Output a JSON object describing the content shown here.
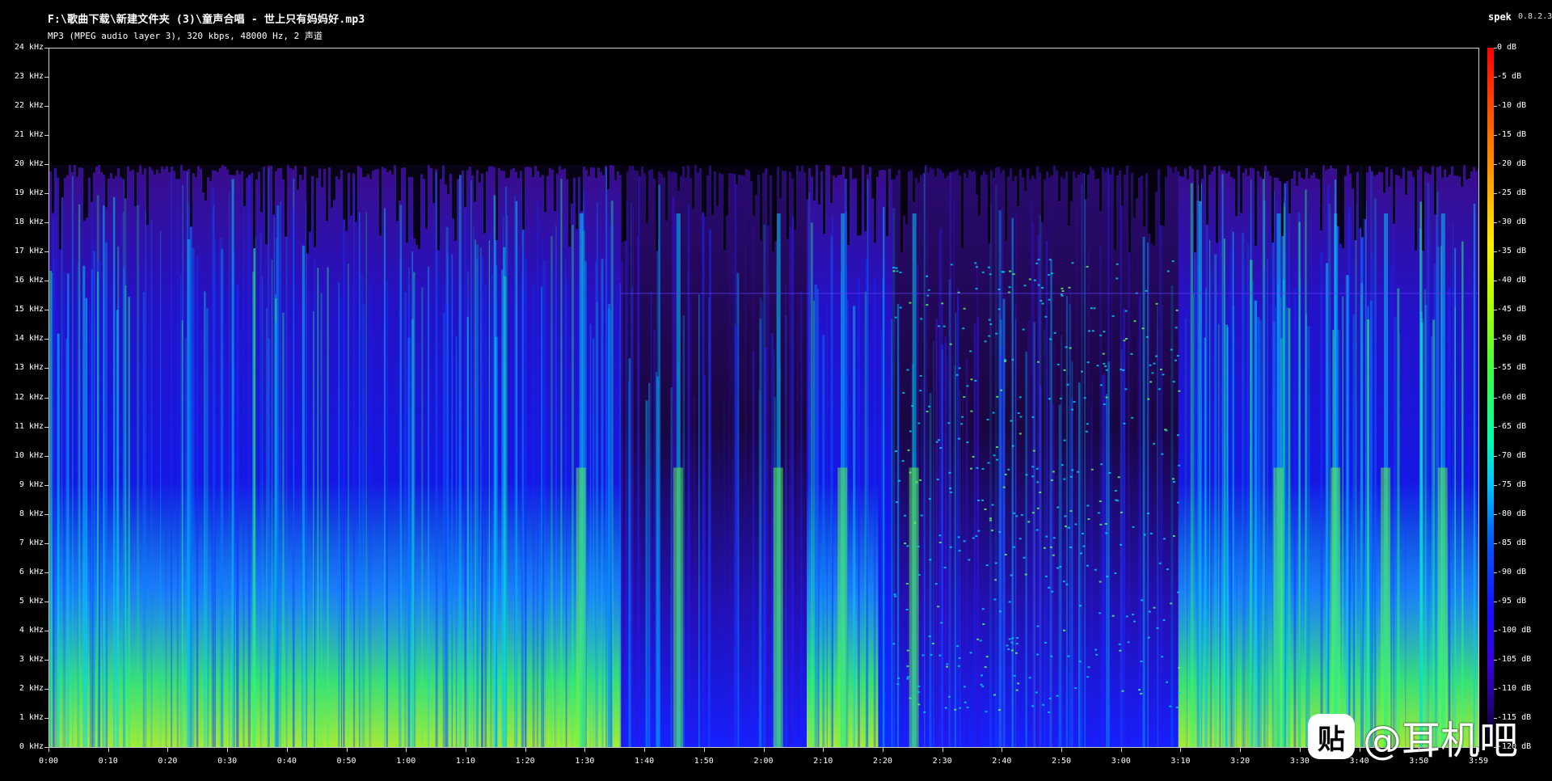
{
  "header": {
    "file_path": "F:\\歌曲下载\\新建文件夹 (3)\\童声合唱 - 世上只有妈妈好.mp3",
    "format_info": "MP3 (MPEG audio layer 3), 320 kbps, 48000 Hz, 2 声道",
    "app_name": "spek",
    "app_version": "0.8.2.3"
  },
  "frequency_axis": {
    "unit": "kHz",
    "ticks": [
      "24 kHz",
      "23 kHz",
      "22 kHz",
      "21 kHz",
      "20 kHz",
      "19 kHz",
      "18 kHz",
      "17 kHz",
      "16 kHz",
      "15 kHz",
      "14 kHz",
      "13 kHz",
      "12 kHz",
      "11 kHz",
      "10 kHz",
      "9 kHz",
      "8 kHz",
      "7 kHz",
      "6 kHz",
      "5 kHz",
      "4 kHz",
      "3 kHz",
      "2 kHz",
      "1 kHz",
      "0 kHz"
    ]
  },
  "time_axis": {
    "ticks": [
      "0:00",
      "0:10",
      "0:20",
      "0:30",
      "0:40",
      "0:50",
      "1:00",
      "1:10",
      "1:20",
      "1:30",
      "1:40",
      "1:50",
      "2:00",
      "2:10",
      "2:20",
      "2:30",
      "2:40",
      "2:50",
      "3:00",
      "3:10",
      "3:20",
      "3:30",
      "3:40",
      "3:50",
      "3:59"
    ]
  },
  "color_scale": {
    "ticks": [
      "0 dB",
      "-5 dB",
      "-10 dB",
      "-15 dB",
      "-20 dB",
      "-25 dB",
      "-30 dB",
      "-35 dB",
      "-40 dB",
      "-45 dB",
      "-50 dB",
      "-55 dB",
      "-60 dB",
      "-65 dB",
      "-70 dB",
      "-75 dB",
      "-80 dB",
      "-85 dB",
      "-90 dB",
      "-95 dB",
      "-100 dB",
      "-105 dB",
      "-110 dB",
      "-115 dB",
      "-120 dB"
    ],
    "colors": [
      "#ff0000",
      "#ffaa00",
      "#ffee00",
      "#40ff40",
      "#00c8ff",
      "#1810ff",
      "#3a00e0",
      "#000000"
    ]
  },
  "spectrogram": {
    "frequency_cutoff_khz": 20,
    "duration": "3:59"
  },
  "watermark": {
    "badge_glyph": "贴",
    "text": "@耳机吧",
    "icon": "tieba-logo-icon"
  }
}
